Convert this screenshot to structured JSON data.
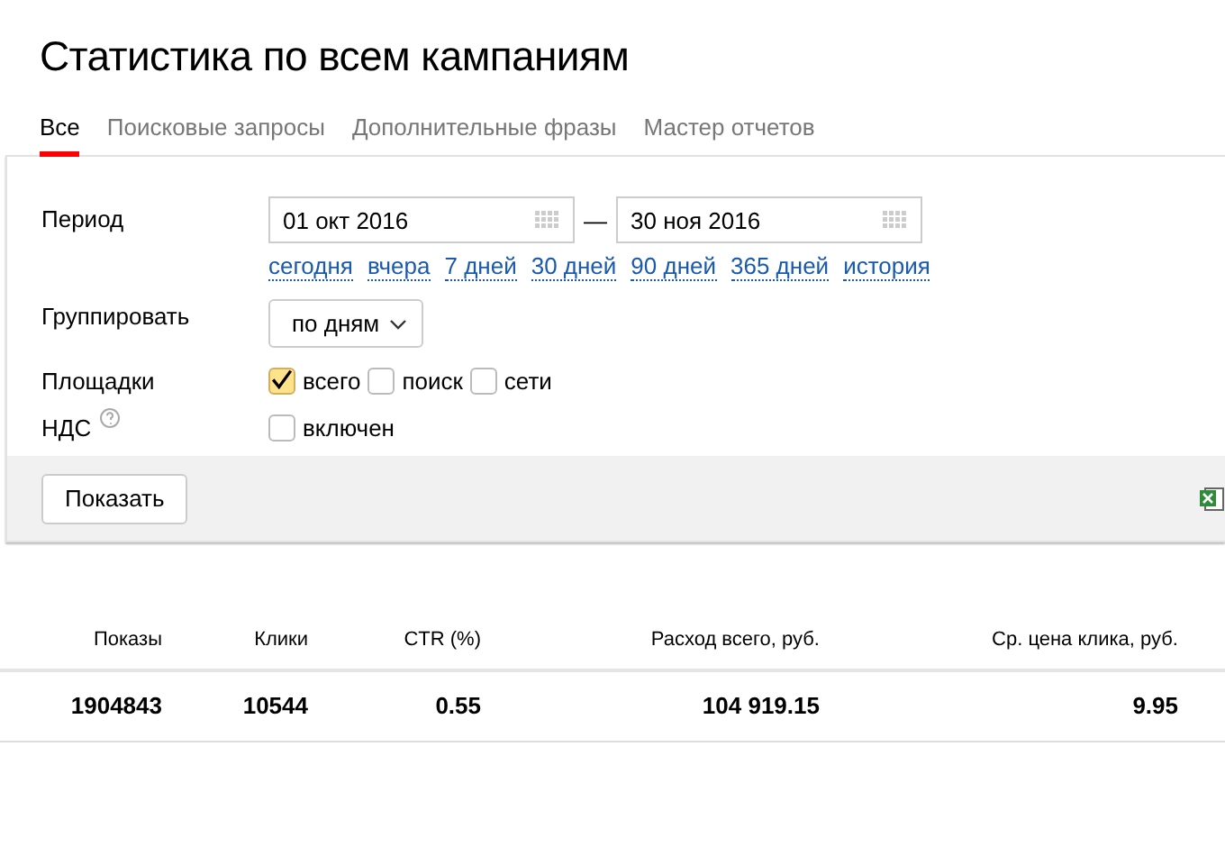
{
  "title": "Статистика по всем кампаниям",
  "tabs": [
    {
      "label": "Все",
      "selected": true
    },
    {
      "label": "Поисковые запросы",
      "selected": false
    },
    {
      "label": "Дополнительные фразы",
      "selected": false
    },
    {
      "label": "Мастер отчетов",
      "selected": false
    }
  ],
  "filters": {
    "period_label": "Период",
    "date_from": "01 окт 2016",
    "dash": "—",
    "date_to": "30 ноя 2016",
    "quick_ranges": [
      "сегодня",
      "вчера",
      "7 дней",
      "30 дней",
      "90 дней",
      "365 дней",
      "история"
    ],
    "group_label": "Группировать",
    "group_value": "по дням",
    "sites_label": "Площадки",
    "sites": [
      {
        "label": "всего",
        "checked": true
      },
      {
        "label": "поиск",
        "checked": false
      },
      {
        "label": "сети",
        "checked": false
      }
    ],
    "vat_label": "НДС",
    "vat": {
      "label": "включен",
      "checked": false
    }
  },
  "show_button": "Показать",
  "table": {
    "columns": [
      "Показы",
      "Клики",
      "CTR (%)",
      "Расход всего, руб.",
      "Ср. цена клика, руб."
    ],
    "rows": [
      [
        "1904843",
        "10544",
        "0.55",
        "104 919.15",
        "9.95"
      ]
    ]
  }
}
